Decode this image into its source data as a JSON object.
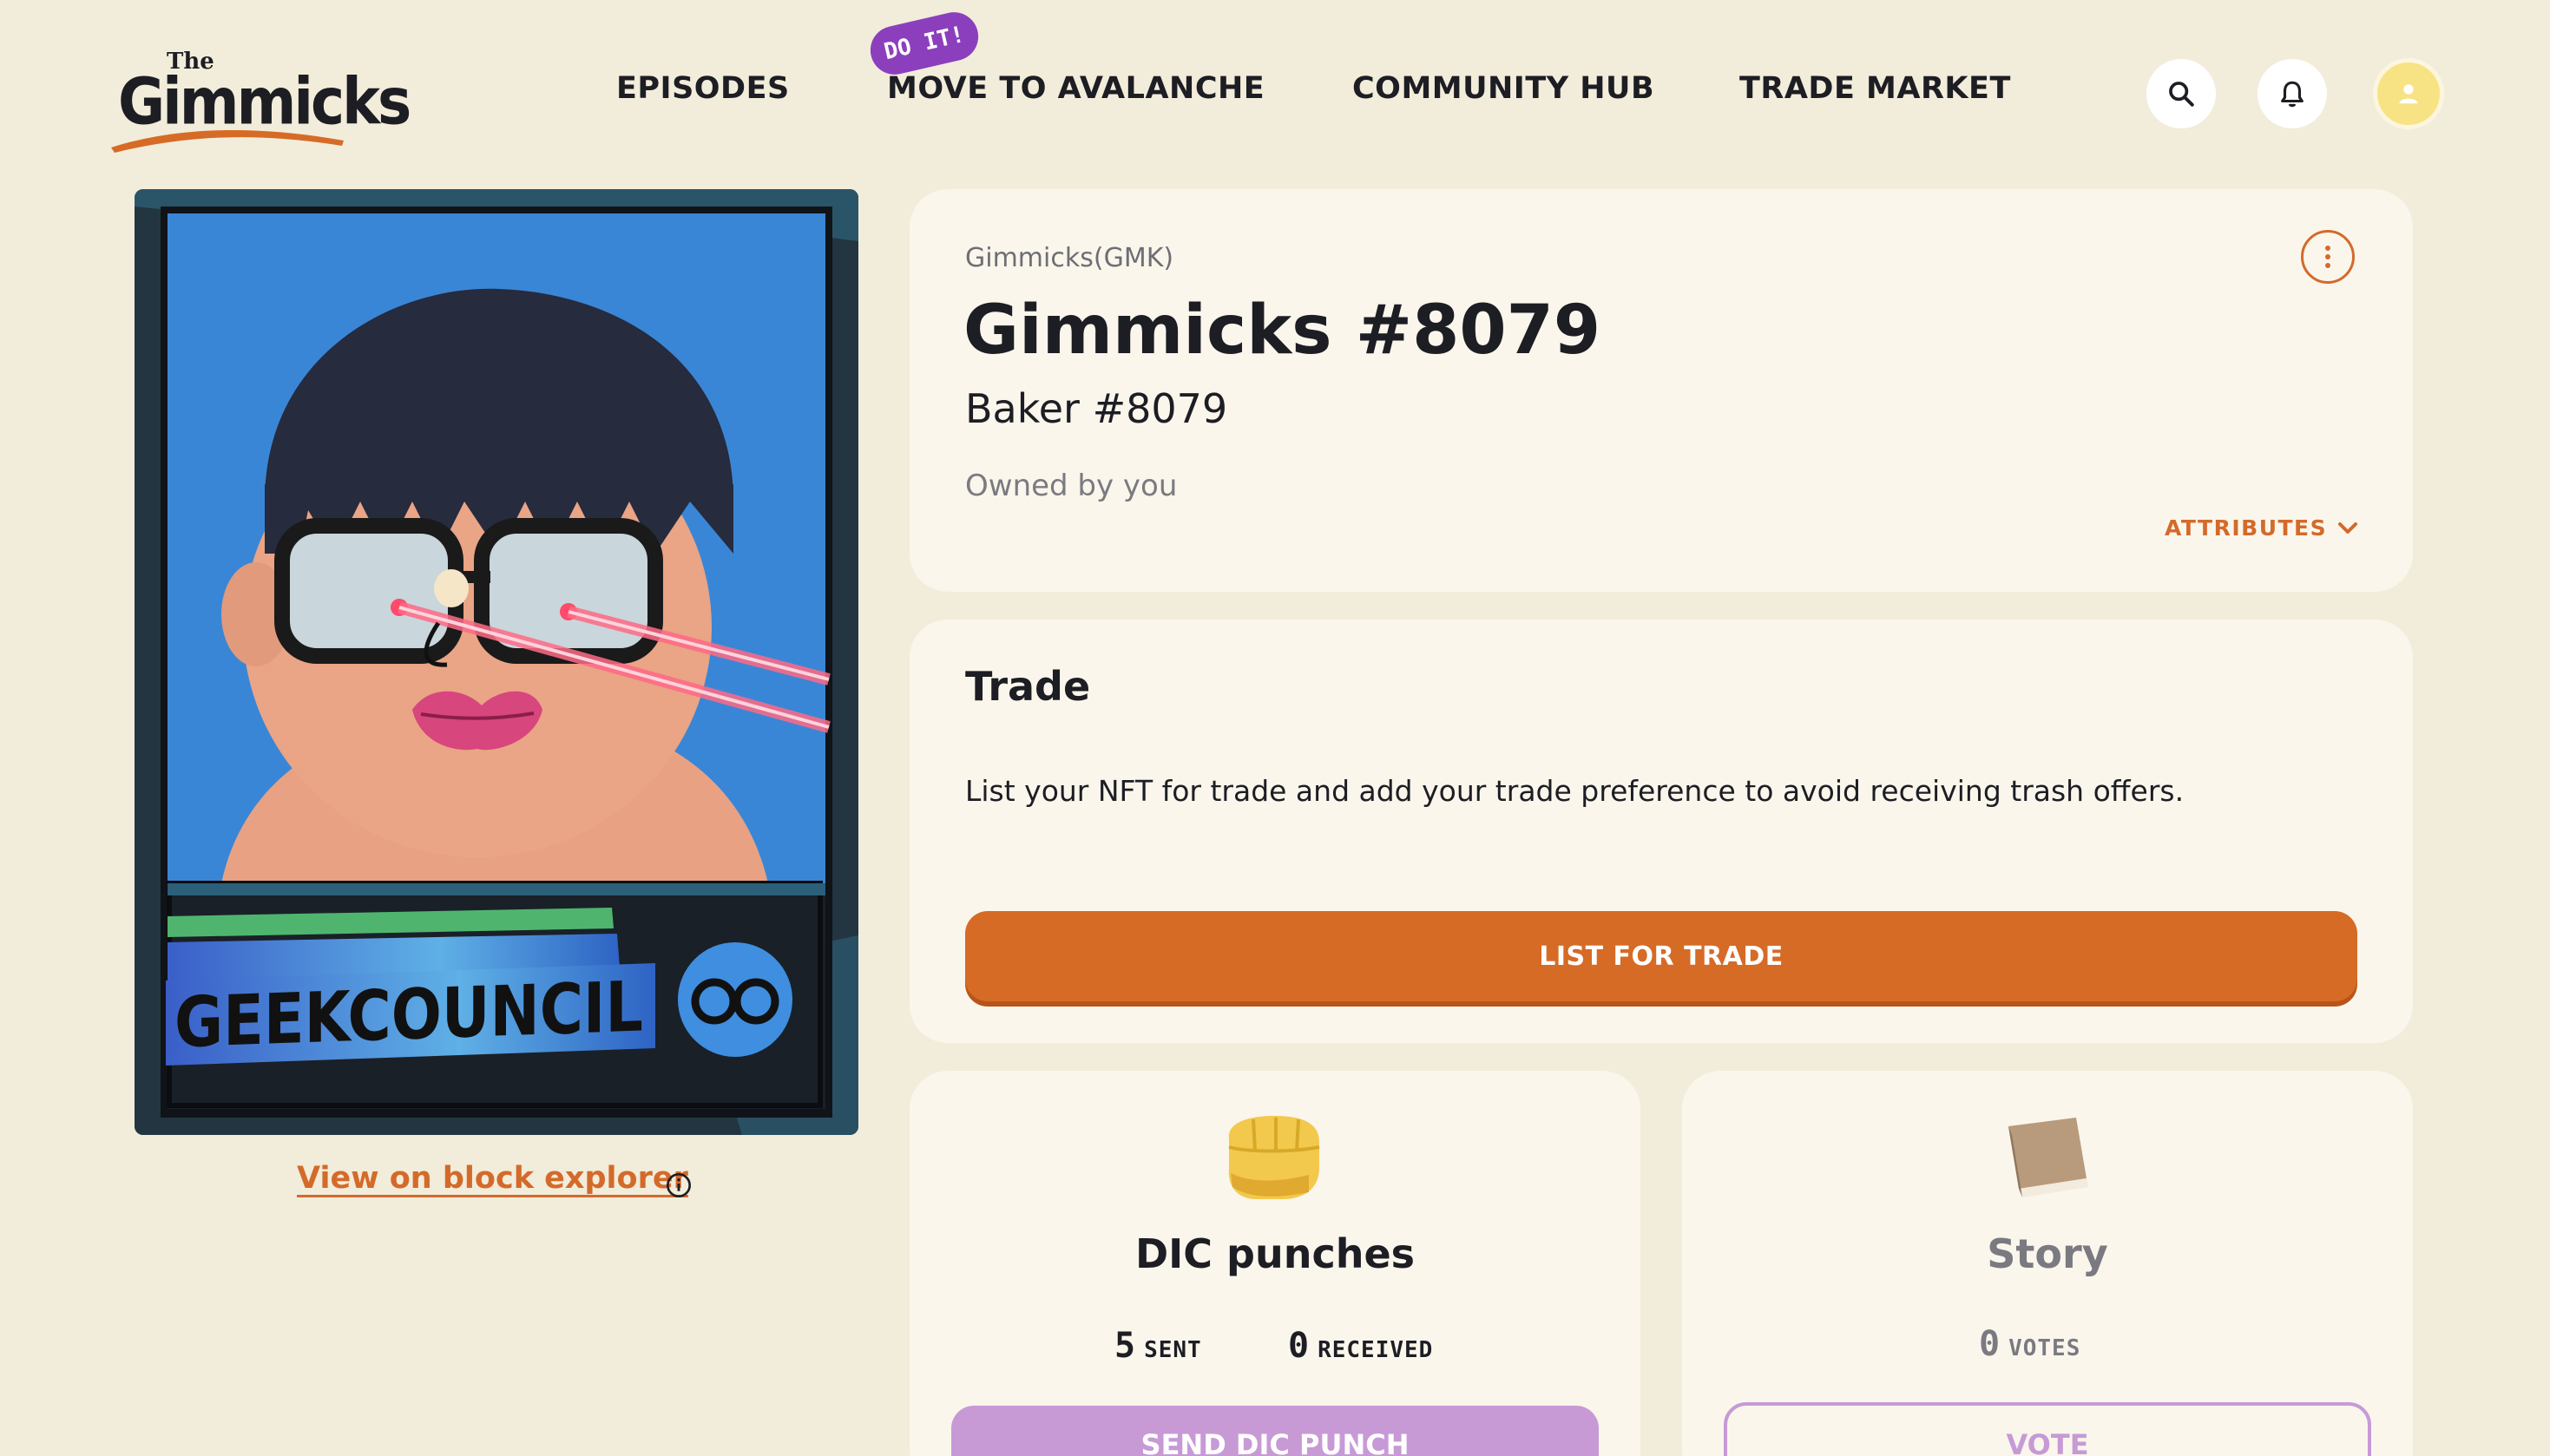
{
  "header": {
    "logo_the": "The",
    "logo_word": "Gimmicks",
    "nav": [
      {
        "label": "EPISODES"
      },
      {
        "label": "MOVE TO AVALANCHE",
        "badge": "DO IT!"
      },
      {
        "label": "COMMUNITY HUB"
      },
      {
        "label": "TRADE MARKET"
      }
    ],
    "icons": [
      "search-icon",
      "bell-icon",
      "user-icon"
    ]
  },
  "card": {
    "banner_text": "GEEKCOUNCIL",
    "explorer_link": "View on block explorer"
  },
  "details": {
    "collection": "Gimmicks(GMK)",
    "title": "Gimmicks #8079",
    "subtitle": "Baker #8079",
    "owner": "Owned by you",
    "attributes_label": "ATTRIBUTES"
  },
  "trade": {
    "heading": "Trade",
    "description": "List your NFT for trade and add your trade preference to avoid receiving trash offers.",
    "button": "LIST FOR TRADE"
  },
  "punches": {
    "title": "DIC punches",
    "sent_count": "5",
    "sent_label": "SENT",
    "received_count": "0",
    "received_label": "RECEIVED",
    "button": "SEND DIC PUNCH"
  },
  "story": {
    "title": "Story",
    "votes_count": "0",
    "votes_label": "VOTES",
    "button": "VOTE"
  },
  "colors": {
    "background": "#f2ecda",
    "panel": "#faf6ec",
    "accent_orange": "#d66b26",
    "purple_badge": "#8b3fbd",
    "lavender_button": "#c79ad6"
  }
}
